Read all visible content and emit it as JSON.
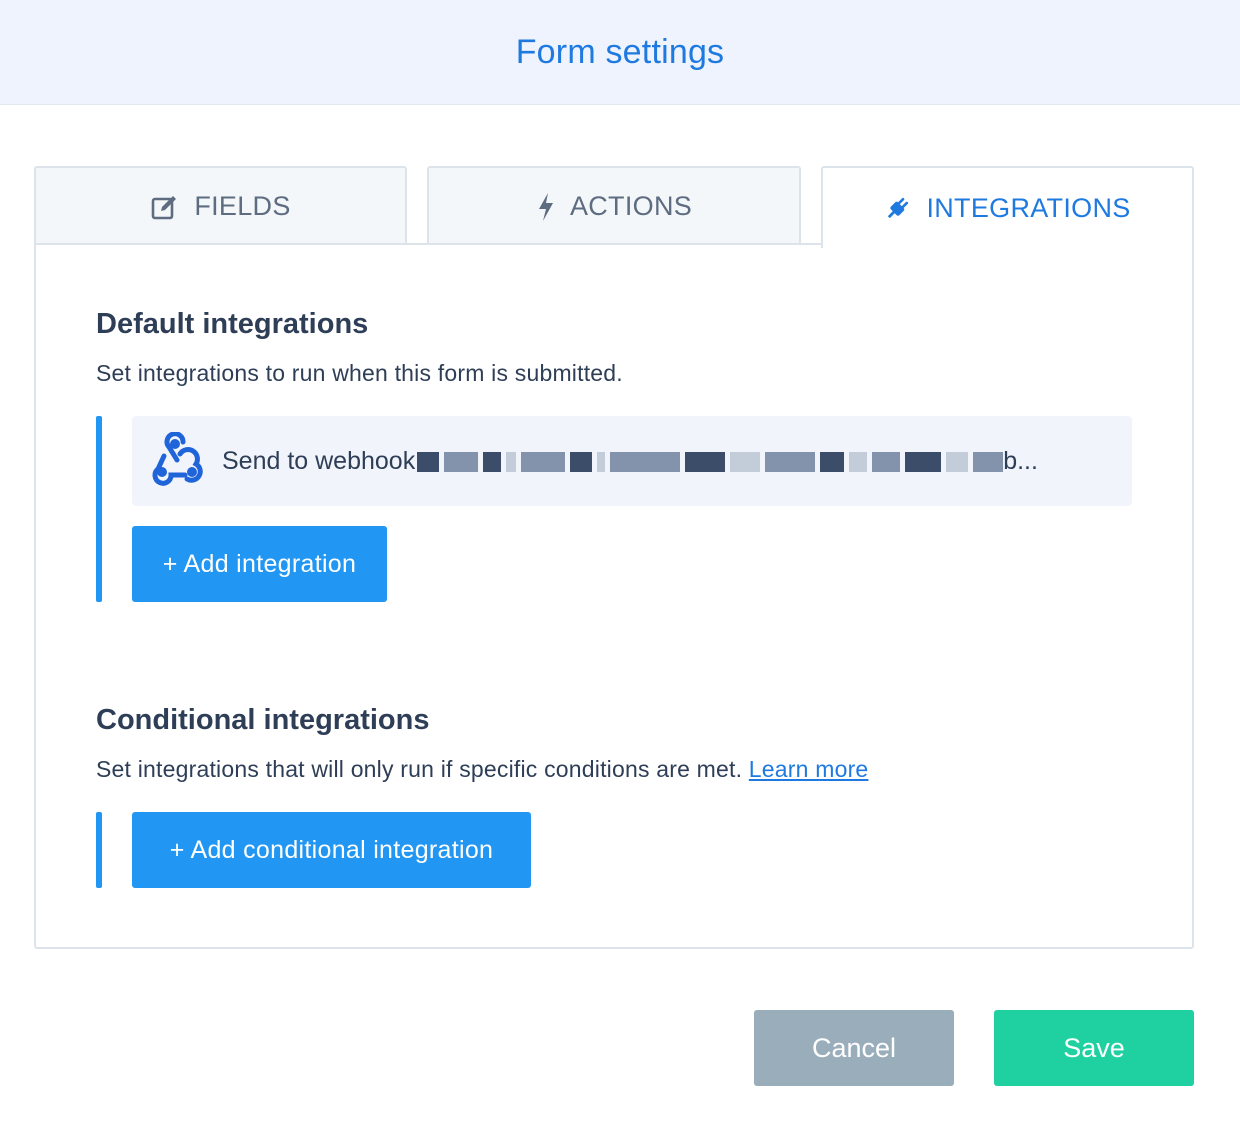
{
  "header": {
    "title": "Form settings"
  },
  "tabs": [
    {
      "label": "FIELDS",
      "icon": "edit-icon"
    },
    {
      "label": "ACTIONS",
      "icon": "lightning-icon"
    },
    {
      "label": "INTEGRATIONS",
      "icon": "plug-icon",
      "active": true
    }
  ],
  "default_integrations": {
    "title": "Default integrations",
    "description": "Set integrations to run when this form is submitted.",
    "items": [
      {
        "label": "Send to webhook",
        "icon": "webhook-icon",
        "suffix": "b..."
      }
    ],
    "add_button": "+ Add integration"
  },
  "conditional_integrations": {
    "title": "Conditional integrations",
    "description": "Set integrations that will only run if specific conditions are met.",
    "learn_more": "Learn more",
    "add_button": "+ Add conditional integration"
  },
  "footer": {
    "cancel_label": "Cancel",
    "save_label": "Save"
  },
  "colors": {
    "accent": "#1f7ae0",
    "primary_button": "#2196f3",
    "save_button": "#1fd1a1",
    "cancel_button": "#9aadbb",
    "header_bg": "#eff3fd"
  }
}
